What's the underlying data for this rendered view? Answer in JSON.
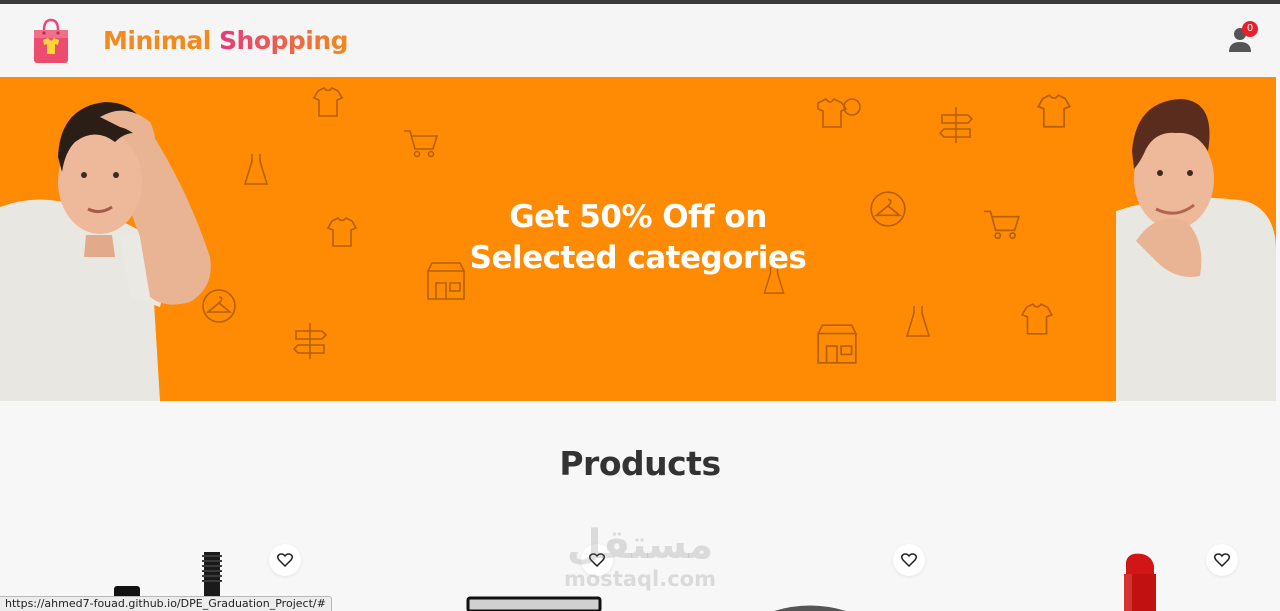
{
  "header": {
    "brand_word1": "Minimal",
    "brand_word2": "Shopping",
    "cart_count": "0"
  },
  "hero": {
    "line1": "Get 50% Off on",
    "line2": "Selected categories",
    "background": "#ff8a04"
  },
  "products": {
    "title": "Products"
  },
  "watermark": {
    "arabic": "مستقل",
    "latin": "mostaql.com"
  },
  "status_bar": {
    "url": "https://ahmed7-fouad.github.io/DPE_Graduation_Project/#"
  },
  "colors": {
    "accent_orange": "#f28a1e",
    "accent_pink": "#e6397a",
    "badge_red": "#e8202b"
  }
}
